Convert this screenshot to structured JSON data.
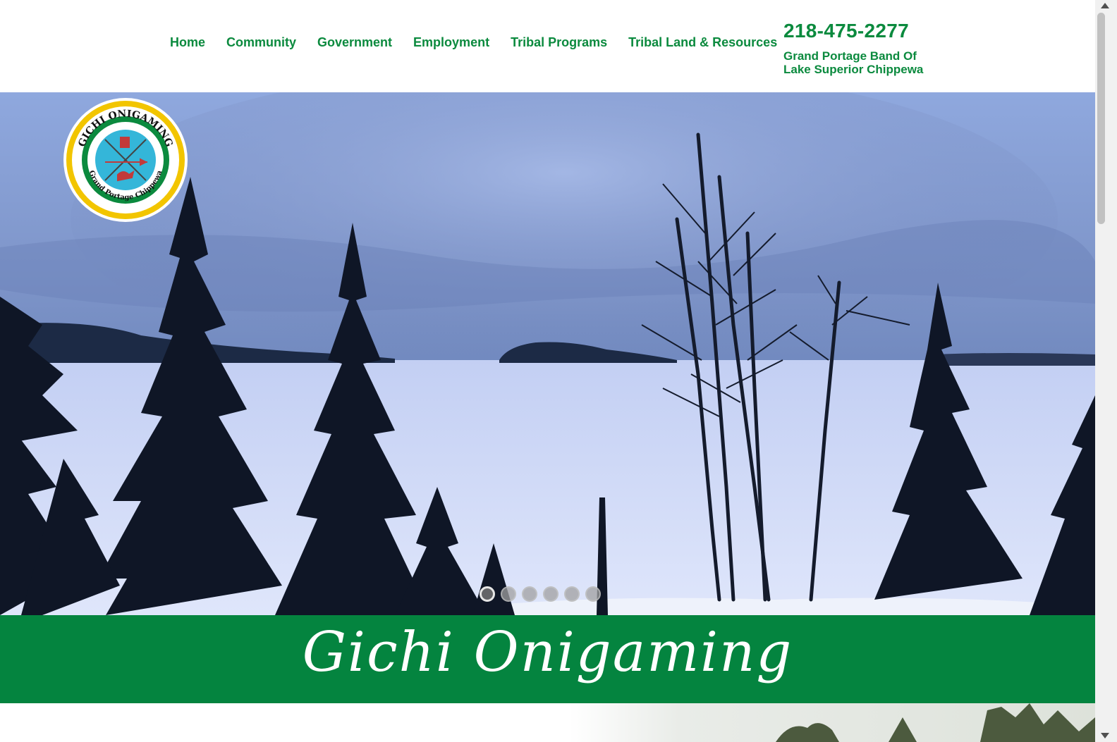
{
  "nav": {
    "items": [
      {
        "label": "Home"
      },
      {
        "label": "Community"
      },
      {
        "label": "Government"
      },
      {
        "label": "Employment"
      },
      {
        "label": "Tribal Programs"
      },
      {
        "label": "Tribal Land & Resources"
      }
    ]
  },
  "contact": {
    "phone": "218-475-2277",
    "tagline": "Grand Portage Band Of Lake Superior Chippewa"
  },
  "logo": {
    "top_text": "GICHI ONIGAMING",
    "bottom_text": "Grand Portage Chippewa"
  },
  "slider": {
    "slide_count": 6,
    "active_index": 0
  },
  "band": {
    "script_title": "Gichi Onigaming",
    "color": "#04843f"
  },
  "colors": {
    "accent_green": "#0b8a3e",
    "logo_yellow": "#f2c500",
    "logo_blue": "#34b6d9"
  }
}
